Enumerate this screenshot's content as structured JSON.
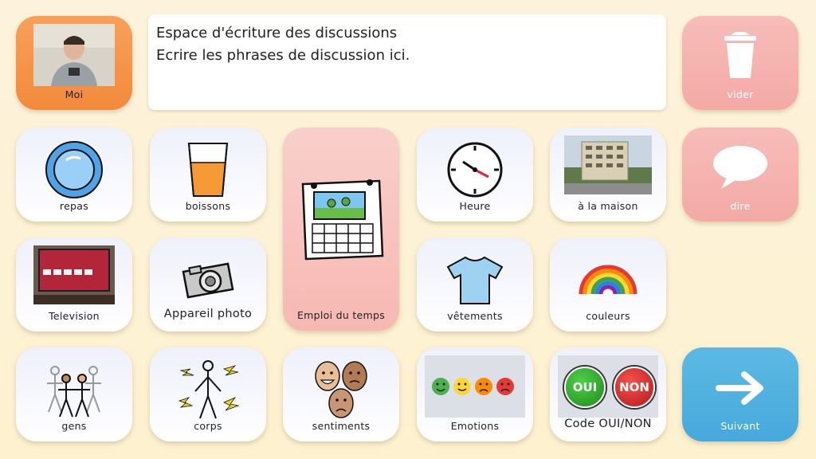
{
  "message_box": {
    "line1": "Espace d'écriture des discussions",
    "line2": "Ecrire les phrases de discussion ici."
  },
  "user_tile": {
    "label": "Moi"
  },
  "actions": {
    "clear_label": "vider",
    "speak_label": "dire",
    "next_label": "Suivant"
  },
  "tiles": {
    "repas": "repas",
    "boissons": "boissons",
    "emploi": "Emploi du temps",
    "heure": "Heure",
    "maison": "à la maison",
    "television": "Television",
    "appareil": "Appareil photo",
    "vetements": "vêtements",
    "couleurs": "couleurs",
    "gens": "gens",
    "corps": "corps",
    "sentiments": "sentiments",
    "emotions": "Emotions",
    "oui_non": "Code OUI/NON"
  },
  "oui_non_badges": {
    "yes": "OUI",
    "no": "NON"
  },
  "colors": {
    "orange": "#f28a3c",
    "pink": "#f4a9a6",
    "blue": "#46a9dc",
    "tile": "#eef0fb",
    "background": "#fdf3dc"
  },
  "icons": {
    "repas": "plate-icon",
    "boissons": "glass-icon",
    "emploi": "calendar-icon",
    "heure": "clock-icon",
    "maison": "building-photo",
    "television": "tv-photo",
    "appareil": "camera-icon",
    "vetements": "tshirt-icon",
    "couleurs": "rainbow-icon",
    "gens": "people-icon",
    "corps": "body-icon",
    "sentiments": "faces-icon",
    "emotions": "emoji-faces-icon",
    "vider": "trash-icon",
    "dire": "speech-bubble-icon",
    "suivant": "arrow-right-icon"
  }
}
